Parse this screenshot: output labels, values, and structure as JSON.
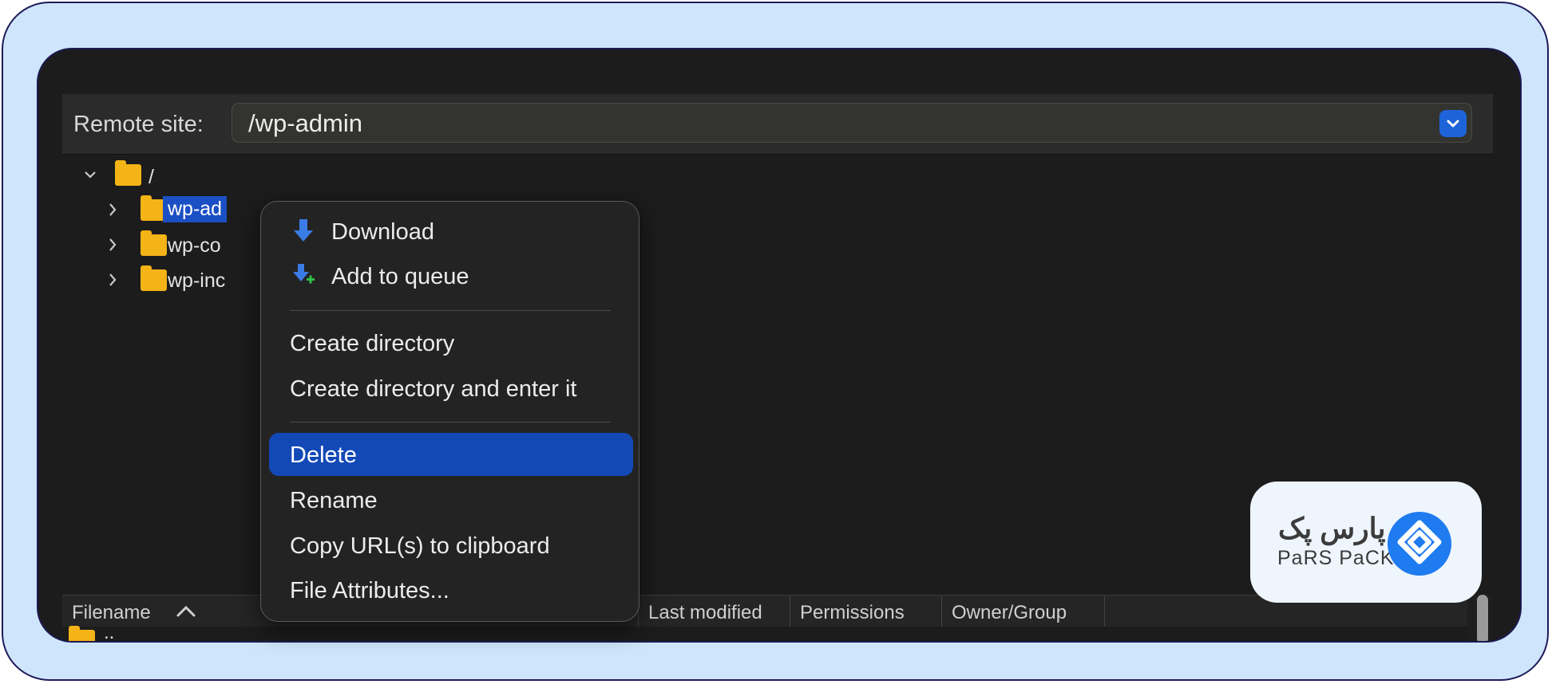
{
  "remote_site": {
    "label": "Remote site:",
    "path": "/wp-admin"
  },
  "tree": {
    "root": "/",
    "items": [
      {
        "label": "wp-ad",
        "selected": true
      },
      {
        "label": "wp-co",
        "selected": false
      },
      {
        "label": "wp-inc",
        "selected": false
      }
    ]
  },
  "context_menu": {
    "items": [
      {
        "label": "Download",
        "icon": "download-arrow-icon"
      },
      {
        "label": "Add to queue",
        "icon": "add-to-queue-icon"
      },
      {
        "label": "Create directory"
      },
      {
        "label": "Create directory and enter it"
      },
      {
        "label": "Delete",
        "highlighted": true
      },
      {
        "label": "Rename"
      },
      {
        "label": "Copy URL(s) to clipboard"
      },
      {
        "label": "File Attributes..."
      }
    ]
  },
  "file_list": {
    "columns": [
      "Filename",
      "Last modified",
      "Permissions",
      "Owner/Group"
    ],
    "rows": [
      {
        "name": ".."
      }
    ]
  },
  "brand": {
    "name_fa": "پارس پک",
    "name_en": "PaRS PaCK",
    "accent": "#1e7bf0"
  },
  "colors": {
    "selection": "#1349b7",
    "folder": "#f4b316",
    "window_bg": "#1c1c1c"
  }
}
